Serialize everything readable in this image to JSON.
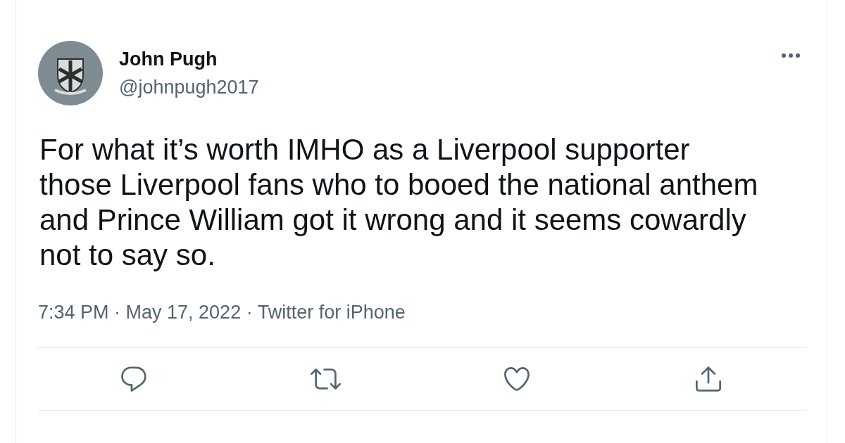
{
  "tweet": {
    "author": {
      "name": "John Pugh",
      "handle": "@johnpugh2017"
    },
    "text": "For what it’s worth IMHO as a Liverpool supporter those Liverpool fans who to booed the national anthem and Prince William got it wrong and it seems cowardly not to say so.",
    "timestamp": "7:34 PM · May 17, 2022 · Twitter for iPhone",
    "actions": [
      {
        "kind": "reply"
      },
      {
        "kind": "retweet"
      },
      {
        "kind": "like"
      },
      {
        "kind": "share"
      }
    ]
  }
}
